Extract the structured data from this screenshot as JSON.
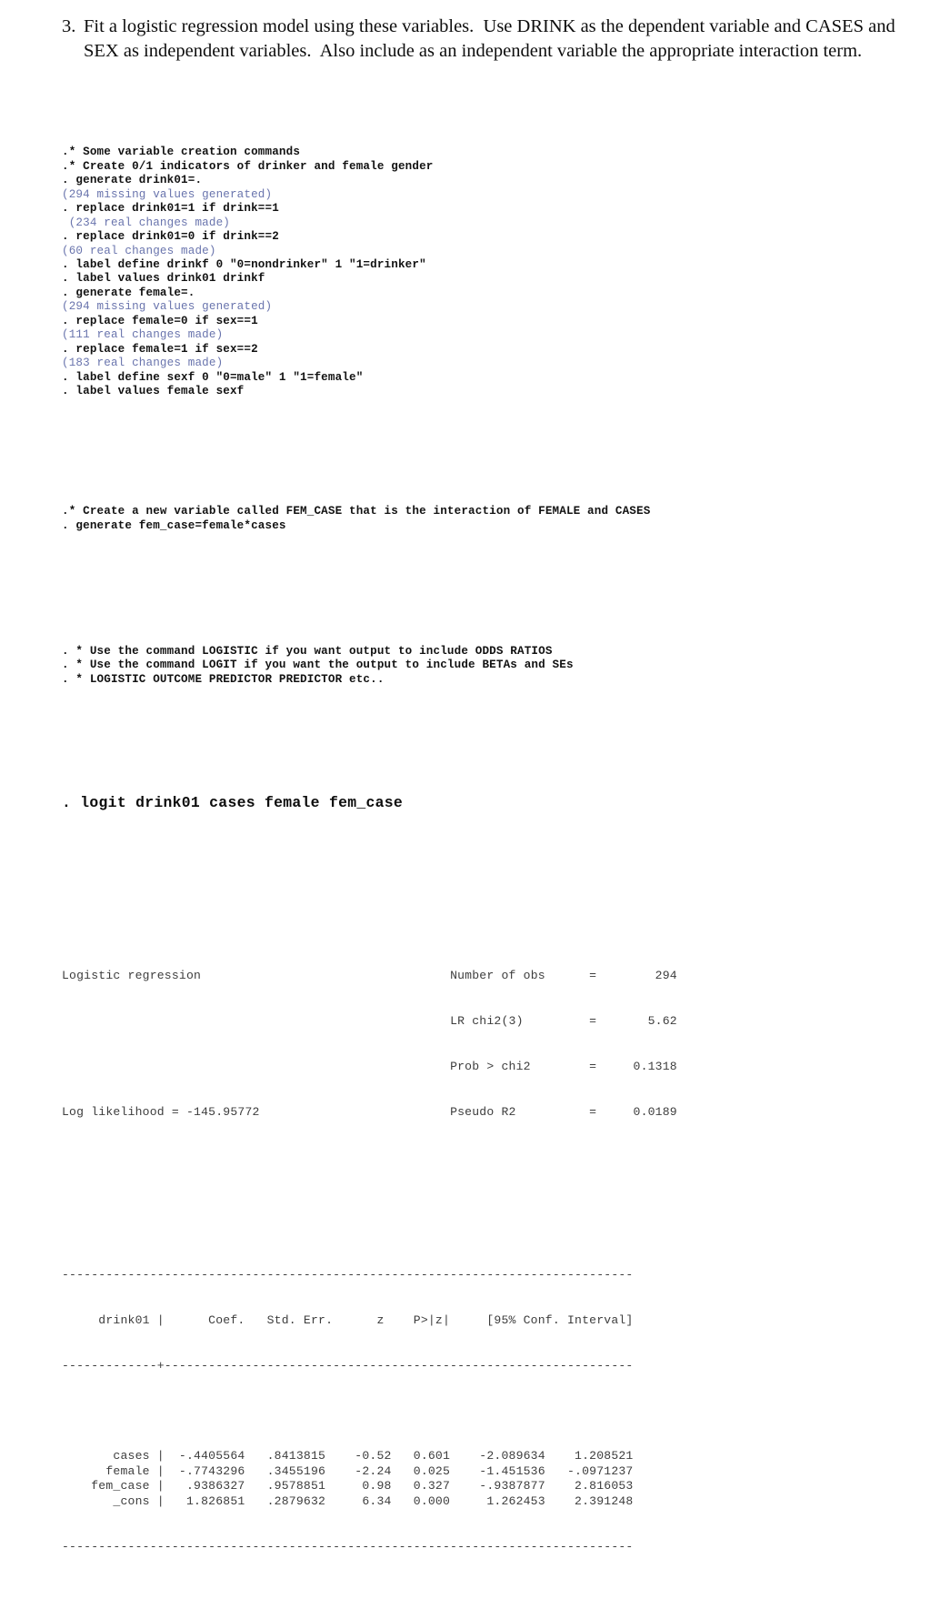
{
  "question": {
    "number": "3.",
    "text": "Fit a logistic regression model using these variables.  Use DRINK as the dependent variable and CASES and SEX as independent variables.  Also include as an independent variable the appropriate interaction term."
  },
  "console": {
    "block1": [
      {
        "kind": "cmd",
        "text": ".* Some variable creation commands"
      },
      {
        "kind": "cmd",
        "text": ".* Create 0/1 indicators of drinker and female gender"
      },
      {
        "kind": "cmd",
        "text": ". generate drink01=."
      },
      {
        "kind": "out",
        "text": "(294 missing values generated)"
      },
      {
        "kind": "cmd",
        "text": ". replace drink01=1 if drink==1"
      },
      {
        "kind": "out",
        "text": " (234 real changes made)"
      },
      {
        "kind": "cmd",
        "text": ". replace drink01=0 if drink==2"
      },
      {
        "kind": "out",
        "text": "(60 real changes made)"
      },
      {
        "kind": "cmd",
        "text": ". label define drinkf 0 \"0=nondrinker\" 1 \"1=drinker\""
      },
      {
        "kind": "cmd",
        "text": ". label values drink01 drinkf"
      },
      {
        "kind": "cmd",
        "text": ". generate female=."
      },
      {
        "kind": "out",
        "text": "(294 missing values generated)"
      },
      {
        "kind": "cmd",
        "text": ". replace female=0 if sex==1"
      },
      {
        "kind": "out",
        "text": "(111 real changes made)"
      },
      {
        "kind": "cmd",
        "text": ". replace female=1 if sex==2"
      },
      {
        "kind": "out",
        "text": "(183 real changes made)"
      },
      {
        "kind": "cmd",
        "text": ". label define sexf 0 \"0=male\" 1 \"1=female\""
      },
      {
        "kind": "cmd",
        "text": ". label values female sexf"
      }
    ],
    "block2": [
      {
        "kind": "cmd",
        "text": ".* Create a new variable called FEM_CASE that is the interaction of FEMALE and CASES"
      },
      {
        "kind": "cmd",
        "text": ". generate fem_case=female*cases"
      }
    ],
    "block3": [
      {
        "kind": "cmd",
        "text": ". * Use the command LOGISTIC if you want output to include ODDS RATIOS"
      },
      {
        "kind": "cmd",
        "text": ". * Use the command LOGIT if you want the output to include BETAs and SEs"
      },
      {
        "kind": "cmd",
        "text": ". * LOGISTIC OUTCOME PREDICTOR PREDICTOR etc.."
      }
    ],
    "logit_command": ". logit drink01 cases female fem_case"
  },
  "regression": {
    "title": "Logistic regression",
    "log_likelihood": "Log likelihood = -145.95772",
    "stats": [
      {
        "label": "Number of obs",
        "eq": "=",
        "value": "294"
      },
      {
        "label": "LR chi2(3)",
        "eq": "=",
        "value": "5.62"
      },
      {
        "label": "Prob > chi2",
        "eq": "=",
        "value": "0.1318"
      },
      {
        "label": "Pseudo R2",
        "eq": "=",
        "value": "0.0189"
      }
    ],
    "rule_top": "------------------------------------------------------------------------------",
    "rule_mid": "-------------+----------------------------------------------------------------",
    "rule_bottom": "------------------------------------------------------------------------------",
    "header_row": "     drink01 |      Coef.   Std. Err.      z    P>|z|     [95% Conf. Interval]",
    "rows": [
      "       cases |  -.4405564   .8413815    -0.52   0.601    -2.089634    1.208521",
      "      female |  -.7743296   .3455196    -2.24   0.025    -1.451536   -.0971237",
      "    fem_case |   .9386327   .9578851     0.98   0.327    -.9387877    2.816053",
      "       _cons |   1.826851   .2879632     6.34   0.000     1.262453    2.391248"
    ],
    "columns": [
      "drink01",
      "Coef.",
      "Std. Err.",
      "z",
      "P>|z|",
      "[95% Conf. Interval]"
    ],
    "table_values": [
      {
        "variable": "cases",
        "coef": "-.4405564",
        "std_err": ".8413815",
        "z": "-0.52",
        "p": "0.601",
        "ci_low": "-2.089634",
        "ci_high": "1.208521"
      },
      {
        "variable": "female",
        "coef": "-.7743296",
        "std_err": ".3455196",
        "z": "-2.24",
        "p": "0.025",
        "ci_low": "-1.451536",
        "ci_high": "-.0971237"
      },
      {
        "variable": "fem_case",
        "coef": ".9386327",
        "std_err": ".9578851",
        "z": "0.98",
        "p": "0.327",
        "ci_low": "-.9387877",
        "ci_high": "2.816053"
      },
      {
        "variable": "_cons",
        "coef": "1.826851",
        "std_err": ".2879632",
        "z": "6.34",
        "p": "0.000",
        "ci_low": "1.262453",
        "ci_high": "2.391248"
      }
    ]
  },
  "colors": {
    "command": "#121212",
    "output": "#6974ad",
    "result": "#3d3d3d",
    "background": "#ffffff"
  }
}
